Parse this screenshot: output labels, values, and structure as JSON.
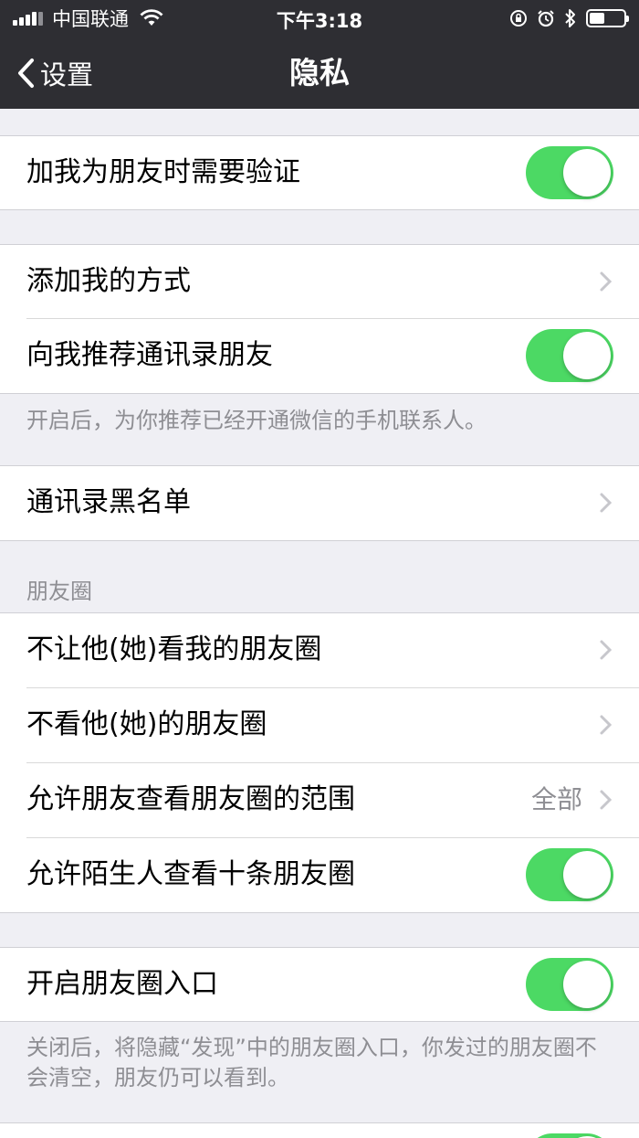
{
  "status_bar": {
    "carrier": "中国联通",
    "time": "下午3:18",
    "battery_level": 0.45
  },
  "nav": {
    "back_label": "设置",
    "title": "隐私"
  },
  "rows": {
    "verify": "加我为朋友时需要验证",
    "add_methods": "添加我的方式",
    "recommend_contacts": "向我推荐通讯录朋友",
    "blacklist": "通讯录黑名单",
    "block_view": "不让他(她)看我的朋友圈",
    "hide_moments": "不看他(她)的朋友圈",
    "moments_range": "允许朋友查看朋友圈的范围",
    "moments_range_value": "全部",
    "stranger_ten": "允许陌生人查看十条朋友圈",
    "moments_entry": "开启朋友圈入口"
  },
  "notes": {
    "recommend_note": "开启后，为你推荐已经开通微信的手机联系人。",
    "entry_note": "关闭后，将隐藏“发现”中的朋友圈入口，你发过的朋友圈不会清空，朋友仍可以看到。"
  },
  "sections": {
    "moments_header": "朋友圈"
  },
  "toggles": {
    "verify": true,
    "recommend_contacts": true,
    "stranger_ten": true,
    "moments_entry": true
  },
  "colors": {
    "switch_on": "#4cd964",
    "nav_bg": "#2e2e33",
    "page_bg": "#efeff4"
  }
}
